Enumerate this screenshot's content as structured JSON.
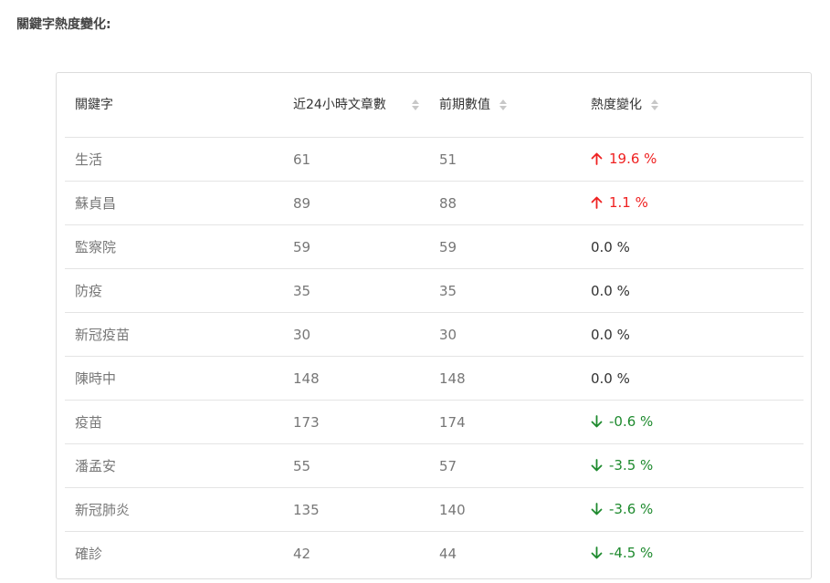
{
  "page_title": "關鍵字熱度變化:",
  "table": {
    "headers": {
      "keyword": "關鍵字",
      "recent": "近24小時文章數",
      "previous": "前期數值",
      "change": "熱度變化"
    },
    "rows": [
      {
        "keyword": "生活",
        "recent": "61",
        "previous": "51",
        "change": "19.6 %",
        "trend": "up"
      },
      {
        "keyword": "蘇貞昌",
        "recent": "89",
        "previous": "88",
        "change": "1.1 %",
        "trend": "up"
      },
      {
        "keyword": "監察院",
        "recent": "59",
        "previous": "59",
        "change": "0.0 %",
        "trend": "flat"
      },
      {
        "keyword": "防疫",
        "recent": "35",
        "previous": "35",
        "change": "0.0 %",
        "trend": "flat"
      },
      {
        "keyword": "新冠疫苗",
        "recent": "30",
        "previous": "30",
        "change": "0.0 %",
        "trend": "flat"
      },
      {
        "keyword": "陳時中",
        "recent": "148",
        "previous": "148",
        "change": "0.0 %",
        "trend": "flat"
      },
      {
        "keyword": "疫苗",
        "recent": "173",
        "previous": "174",
        "change": "-0.6 %",
        "trend": "down"
      },
      {
        "keyword": "潘孟安",
        "recent": "55",
        "previous": "57",
        "change": "-3.5 %",
        "trend": "down"
      },
      {
        "keyword": "新冠肺炎",
        "recent": "135",
        "previous": "140",
        "change": "-3.6 %",
        "trend": "down"
      },
      {
        "keyword": "確診",
        "recent": "42",
        "previous": "44",
        "change": "-4.5 %",
        "trend": "down"
      }
    ]
  },
  "colors": {
    "up": "#ef2121",
    "down": "#1e8a2e",
    "flat": "#333333"
  },
  "icons": {
    "sort": "sort-icon",
    "up": "arrow-up-icon",
    "down": "arrow-down-icon"
  }
}
